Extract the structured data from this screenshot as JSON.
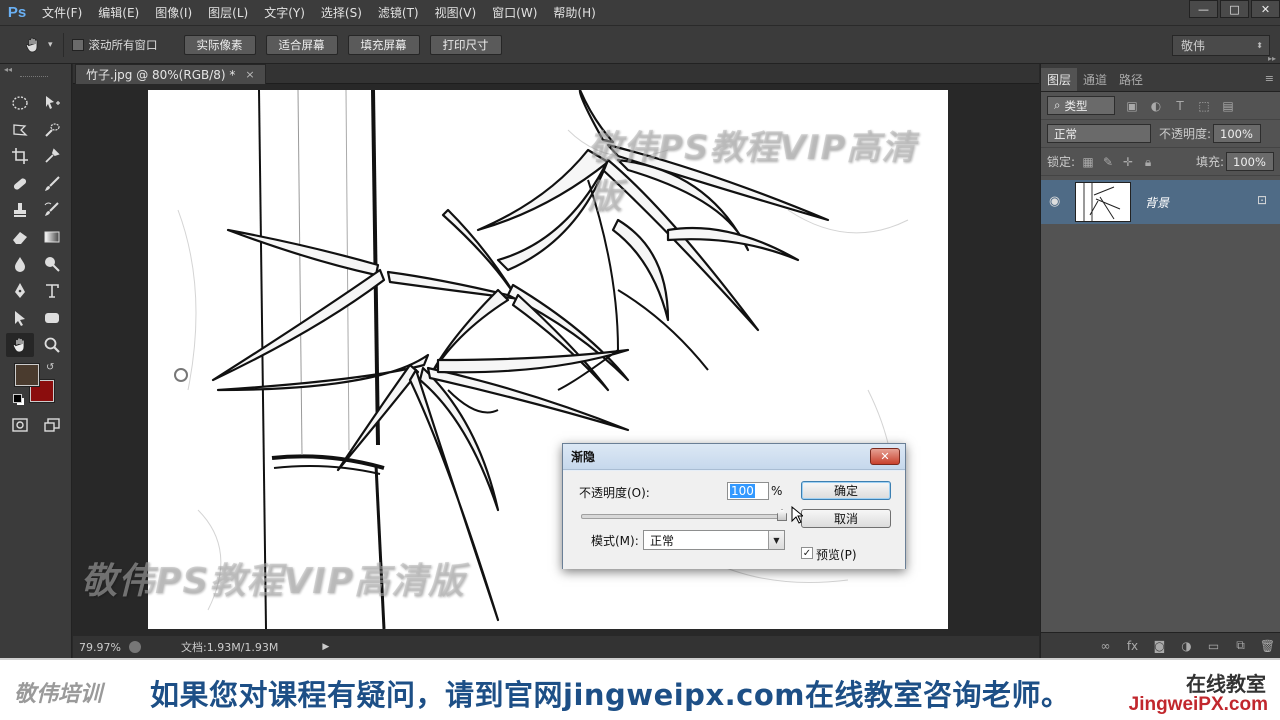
{
  "app": {
    "logo": "Ps",
    "menu": [
      "文件(F)",
      "编辑(E)",
      "图像(I)",
      "图层(L)",
      "文字(Y)",
      "选择(S)",
      "滤镜(T)",
      "视图(V)",
      "窗口(W)",
      "帮助(H)"
    ],
    "window_controls": {
      "minimize": "—",
      "restore": "□",
      "close": "✕"
    }
  },
  "options_bar": {
    "scroll_all_label": "滚动所有窗口",
    "buttons": [
      "实际像素",
      "适合屏幕",
      "填充屏幕",
      "打印尺寸"
    ],
    "workspace": "敬伟"
  },
  "document": {
    "tab_title": "竹子.jpg @ 80%(RGB/8) *",
    "tab_close": "×",
    "zoom": "79.97%",
    "doc_info": "文档:1.93M/1.93M"
  },
  "watermark": {
    "text": "敬伟PS教程VIP高清版"
  },
  "layers_panel": {
    "tabs": [
      "图层",
      "通道",
      "路径"
    ],
    "filter_label": "类型",
    "blend_mode": "正常",
    "opacity_label": "不透明度:",
    "opacity_value": "100%",
    "lock_label": "锁定:",
    "fill_label": "填充:",
    "fill_value": "100%",
    "layer_name": "背景"
  },
  "fade_dialog": {
    "title": "渐隐",
    "opacity_label": "不透明度(O):",
    "opacity_value": "100",
    "percent": "%",
    "ok_label": "确定",
    "cancel_label": "取消",
    "mode_label": "模式(M):",
    "mode_value": "正常",
    "preview_label": "预览(P)",
    "preview_checked": true,
    "opacity_fraction": 1.0
  },
  "banner": {
    "logo": "敬伟培训",
    "message": "如果您对课程有疑问，请到官网jingweipx.com在线教室咨询老师。",
    "right_top": "在线教室",
    "right_bottom": "JingweiPX.com"
  },
  "colors": {
    "foreground": "#4a3b2e",
    "background": "#8b0d0d",
    "layer_selected": "#4f6b86",
    "banner_text": "#1d4f86"
  }
}
